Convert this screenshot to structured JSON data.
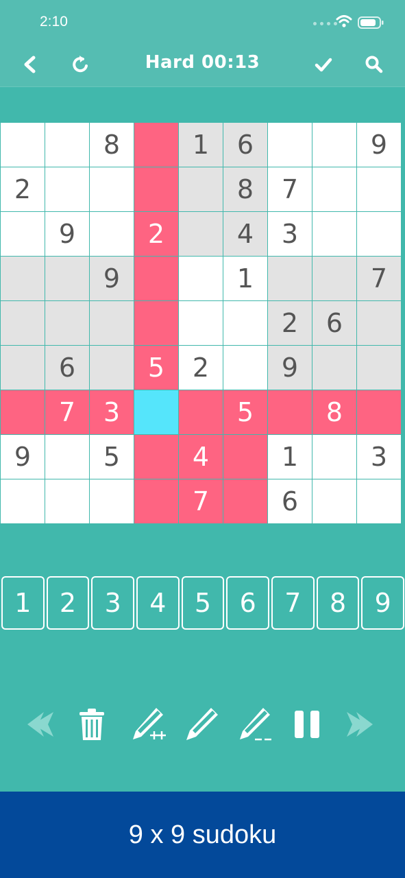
{
  "status_bar": {
    "time": "2:10"
  },
  "toolbar": {
    "title": "Hard 00:13"
  },
  "colors": {
    "background": "#41b8ac",
    "header": "#55bdb2",
    "highlight": "#fe6482",
    "selected": "#55e5fb",
    "block_shade": "#e3e3e3",
    "given_digit": "#555555",
    "banner": "#03499a"
  },
  "board": {
    "selected_cell": [
      6,
      3
    ],
    "rows": [
      [
        "",
        "",
        "8",
        "",
        "1",
        "6",
        "",
        "",
        "9"
      ],
      [
        "2",
        "",
        "",
        "",
        "",
        "8",
        "7",
        "",
        ""
      ],
      [
        "",
        "9",
        "",
        "2",
        "",
        "4",
        "3",
        "",
        ""
      ],
      [
        "",
        "",
        "9",
        "",
        "",
        "1",
        "",
        "",
        "7"
      ],
      [
        "",
        "",
        "",
        "",
        "",
        "",
        "2",
        "6",
        ""
      ],
      [
        "",
        "6",
        "",
        "5",
        "2",
        "",
        "9",
        "",
        ""
      ],
      [
        "",
        "7",
        "3",
        "",
        "",
        "5",
        "",
        "8",
        ""
      ],
      [
        "9",
        "",
        "5",
        "",
        "4",
        "",
        "1",
        "",
        "3"
      ],
      [
        "",
        "",
        "",
        "",
        "7",
        "",
        "6",
        "",
        ""
      ]
    ]
  },
  "number_pad": [
    "1",
    "2",
    "3",
    "4",
    "5",
    "6",
    "7",
    "8",
    "9"
  ],
  "tools": [
    "undo-arrow-icon",
    "trash-icon",
    "pencil-plus-icon",
    "pencil-icon",
    "pencil-minus-icon",
    "pause-icon",
    "redo-arrow-icon"
  ],
  "banner": {
    "text": "9 x 9 sudoku"
  }
}
